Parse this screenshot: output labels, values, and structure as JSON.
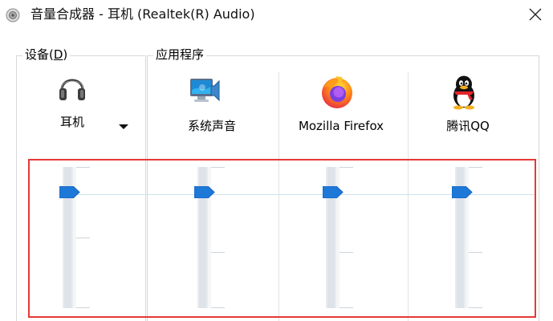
{
  "window": {
    "title": "音量合成器 - 耳机 (Realtek(R) Audio)",
    "app_icon": "speaker-icon",
    "close_icon": "close-icon"
  },
  "groups": {
    "devices": {
      "label_main": "设备(",
      "label_mnemonic": "D",
      "label_close": ")"
    },
    "apps": {
      "label": "应用程序"
    }
  },
  "columns": [
    {
      "label": "耳机",
      "icon": "headphones-icon",
      "has_dropdown": true,
      "volume_percent": 82
    },
    {
      "label": "系统声音",
      "icon": "system-sounds-icon",
      "has_dropdown": false,
      "volume_percent": 82
    },
    {
      "label": "Mozilla Firefox",
      "icon": "firefox-icon",
      "has_dropdown": false,
      "volume_percent": 82
    },
    {
      "label": "腾讯QQ",
      "icon": "qq-penguin-icon",
      "has_dropdown": false,
      "volume_percent": 82
    }
  ],
  "colors": {
    "thumb": "#1e78d7",
    "highlight_border": "#e53935",
    "track": "#e8ecef"
  }
}
